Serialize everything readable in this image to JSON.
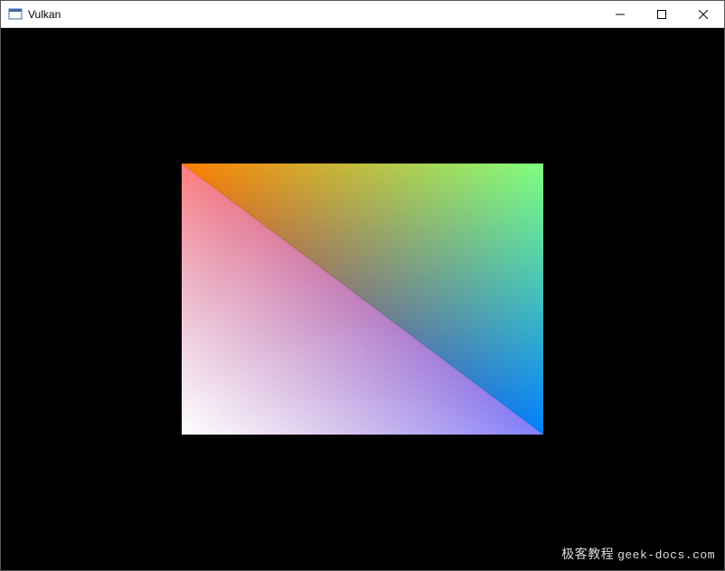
{
  "window": {
    "title": "Vulkan"
  },
  "render": {
    "vertices": [
      {
        "pos": "top-left",
        "color": "#FF0000"
      },
      {
        "pos": "top-right",
        "color": "#00FF00"
      },
      {
        "pos": "bottom-right",
        "color": "#0000FF"
      },
      {
        "pos": "bottom-left",
        "color": "#FFFFFF"
      }
    ],
    "background": "#000000"
  },
  "watermark": {
    "zh": "极客教程",
    "en": "geek-docs.com"
  }
}
